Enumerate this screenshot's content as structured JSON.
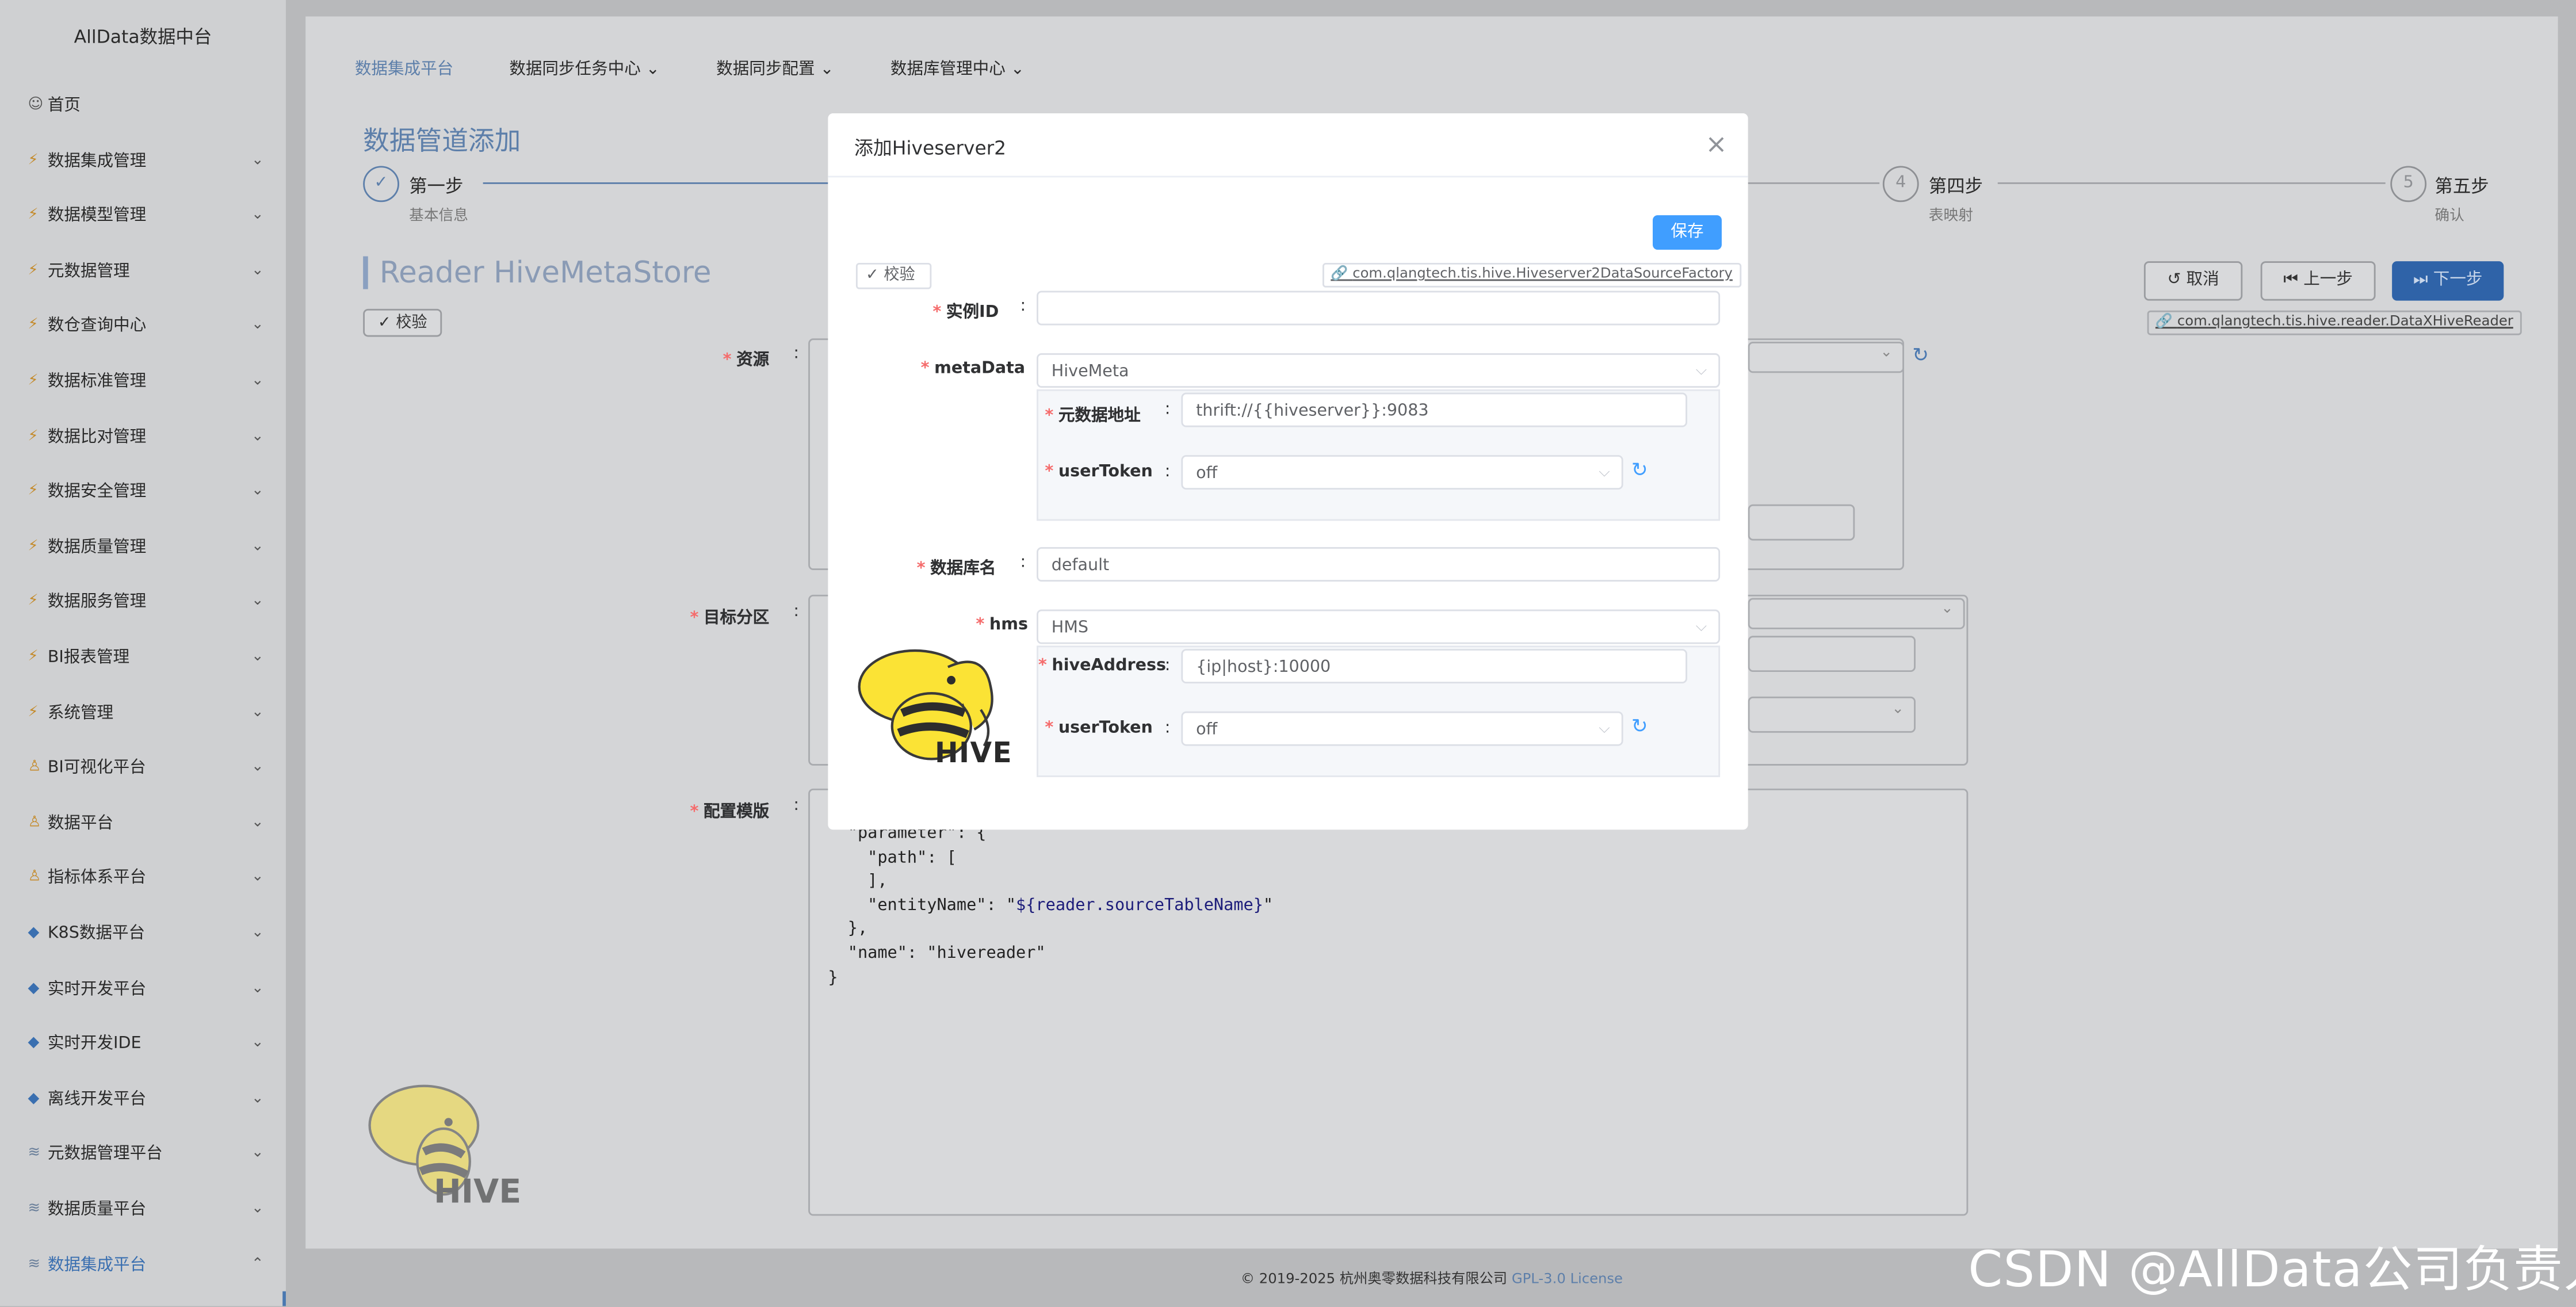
{
  "sidebar": {
    "brand": "AllData数据中台",
    "items": [
      {
        "label": "首页",
        "icon": "user-icon",
        "chevron": ""
      },
      {
        "label": "数据集成管理",
        "icon": "bolt-icon",
        "chevron": "⌄"
      },
      {
        "label": "数据模型管理",
        "icon": "bolt-icon",
        "chevron": "⌄"
      },
      {
        "label": "元数据管理",
        "icon": "bolt-icon",
        "chevron": "⌄"
      },
      {
        "label": "数仓查询中心",
        "icon": "bolt-icon",
        "chevron": "⌄"
      },
      {
        "label": "数据标准管理",
        "icon": "bolt-icon",
        "chevron": "⌄"
      },
      {
        "label": "数据比对管理",
        "icon": "bolt-icon",
        "chevron": "⌄"
      },
      {
        "label": "数据安全管理",
        "icon": "bolt-icon",
        "chevron": "⌄"
      },
      {
        "label": "数据质量管理",
        "icon": "bolt-icon",
        "chevron": "⌄"
      },
      {
        "label": "数据服务管理",
        "icon": "bolt-icon",
        "chevron": "⌄"
      },
      {
        "label": "BI报表管理",
        "icon": "bolt-icon",
        "chevron": "⌄"
      },
      {
        "label": "系统管理",
        "icon": "bolt-icon",
        "chevron": "⌄"
      },
      {
        "label": "BI可视化平台",
        "icon": "person-icon",
        "chevron": "⌄"
      },
      {
        "label": "数据平台",
        "icon": "person-icon",
        "chevron": "⌄"
      },
      {
        "label": "指标体系平台",
        "icon": "person-icon",
        "chevron": "⌄"
      },
      {
        "label": "K8S数据平台",
        "icon": "diamond-icon",
        "chevron": "⌄"
      },
      {
        "label": "实时开发平台",
        "icon": "diamond-icon",
        "chevron": "⌄"
      },
      {
        "label": "实时开发IDE",
        "icon": "diamond-icon",
        "chevron": "⌄"
      },
      {
        "label": "离线开发平台",
        "icon": "diamond-icon",
        "chevron": "⌄"
      },
      {
        "label": "元数据管理平台",
        "icon": "stack-icon",
        "chevron": "⌄"
      },
      {
        "label": "数据质量平台",
        "icon": "stack-icon",
        "chevron": "⌄"
      },
      {
        "label": "数据集成平台",
        "icon": "stack-icon",
        "chevron": "⌃"
      }
    ]
  },
  "topnav": {
    "home": "数据集成平台",
    "tasks": "数据同步任务中心 ⌄",
    "config": "数据同步配置 ⌄",
    "db": "数据库管理中心 ⌄"
  },
  "page": {
    "title": "数据管道添加",
    "reader_title": "Reader HiveMetaStore",
    "verify": "校验",
    "resource_label": "资源",
    "partition_label": "目标分区",
    "template_label": "配置模版",
    "plugin_link": "com.qlangtech.tis.hive.reader.DataXHiveReader",
    "cancel": "取消",
    "prev": "上一步",
    "next": "下一步",
    "logo_text": "HIVE"
  },
  "steps": [
    {
      "num": "✓",
      "title": "第一步",
      "sub": "基本信息"
    },
    {
      "num": "4",
      "title": "第四步",
      "sub": "表映射"
    },
    {
      "num": "5",
      "title": "第五步",
      "sub": "确认"
    }
  ],
  "code": {
    "line1": "  \"parameter\": {",
    "line2": "    \"path\": [",
    "line3": "    ],",
    "line4a": "    \"entityName\": \"",
    "line4b": "${reader.sourceTableName}",
    "line4c": "\"",
    "line5": "  },",
    "line6": "  \"name\": \"hivereader\"",
    "line7": "}"
  },
  "modal": {
    "title": "添加Hiveserver2",
    "close": "×",
    "save": "保存",
    "verify": "校验",
    "plugin_link": "com.qlangtech.tis.hive.Hiveserver2DataSourceFactory",
    "instance_label": "实例ID",
    "instance_value": "",
    "metadata_label": "metaData",
    "metadata_value": "HiveMeta",
    "meta_addr_label": "元数据地址",
    "meta_addr_value": "thrift://{{hiveserver}}:9083",
    "user_token_label": "userToken",
    "user_token_value": "off",
    "dbname_label": "数据库名",
    "dbname_value": "default",
    "hms_label": "hms",
    "hms_value": "HMS",
    "hive_addr_label": "hiveAddress",
    "hive_addr_value": "{ip|host}:10000",
    "hms_token_label": "userToken",
    "hms_token_value": "off",
    "logo_text": "HIVE"
  },
  "footer": {
    "text": "© 2019-2025 杭州奥零数据科技有限公司 ",
    "license": "GPL-3.0 License"
  },
  "watermark": "CSDN @AllData公司负责人",
  "colors": {
    "primary": "#409eff",
    "required": "#f56c6c",
    "nav_accent": "#5d7faa"
  }
}
